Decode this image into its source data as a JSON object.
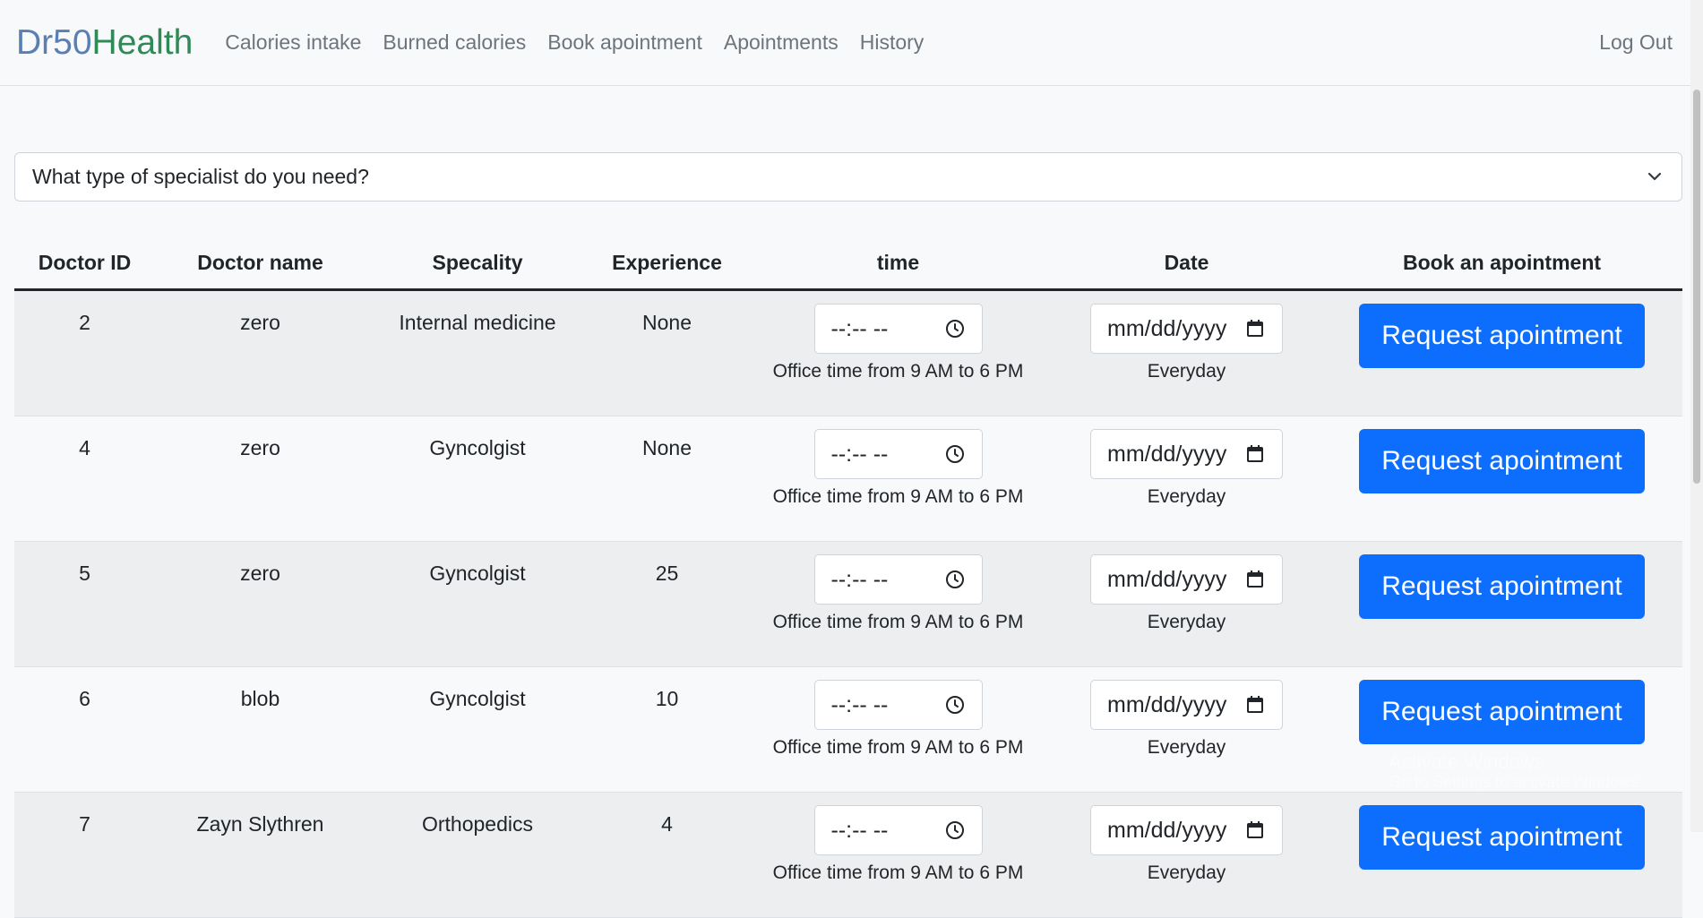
{
  "nav": {
    "brand_part1": "Dr50",
    "brand_part2": "Health",
    "links": [
      "Calories intake",
      "Burned calories",
      "Book apointment",
      "Apointments",
      "History"
    ],
    "logout": "Log Out"
  },
  "specialist_select": {
    "placeholder": "What type of specialist do you need?"
  },
  "table": {
    "headers": [
      "Doctor ID",
      "Doctor name",
      "Specality",
      "Experience",
      "time",
      "Date",
      "Book an apointment"
    ],
    "time_placeholder": "--:-- --",
    "date_placeholder": "mm/dd/yyyy",
    "time_hint": "Office time from 9 AM to 6 PM",
    "date_hint": "Everyday",
    "button_label": "Request apointment",
    "rows": [
      {
        "id": "2",
        "name": "zero",
        "speciality": "Internal medicine",
        "experience": "None"
      },
      {
        "id": "4",
        "name": "zero",
        "speciality": "Gyncolgist",
        "experience": "None"
      },
      {
        "id": "5",
        "name": "zero",
        "speciality": "Gyncolgist",
        "experience": "25"
      },
      {
        "id": "6",
        "name": "blob",
        "speciality": "Gyncolgist",
        "experience": "10"
      },
      {
        "id": "7",
        "name": "Zayn Slythren",
        "speciality": "Orthopedics",
        "experience": "4"
      }
    ]
  },
  "watermark": {
    "line1": "Activate Windows",
    "line2": "Go to Settings to activate Windows."
  },
  "colors": {
    "primary": "#0d6efd",
    "brand_blue": "#5a7fb5",
    "brand_green": "#2e8b57"
  }
}
